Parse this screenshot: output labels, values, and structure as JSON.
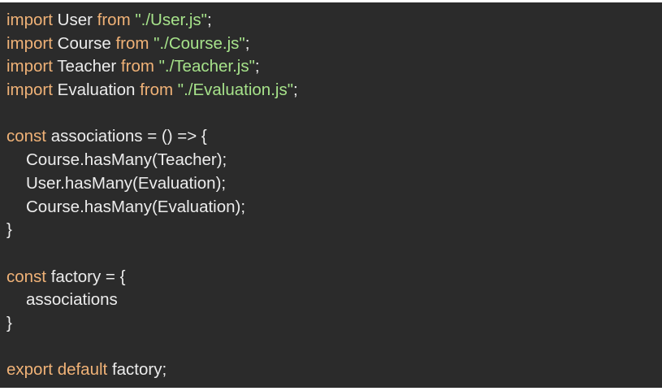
{
  "editor": {
    "lines": [
      {
        "t": [
          {
            "k": "kw",
            "v": "import"
          },
          {
            "k": "plain",
            "v": " User "
          },
          {
            "k": "kw",
            "v": "from"
          },
          {
            "k": "plain",
            "v": " "
          },
          {
            "k": "str",
            "v": "\"./User.js\""
          },
          {
            "k": "plain",
            "v": ";"
          }
        ]
      },
      {
        "t": [
          {
            "k": "kw",
            "v": "import"
          },
          {
            "k": "plain",
            "v": " Course "
          },
          {
            "k": "kw",
            "v": "from"
          },
          {
            "k": "plain",
            "v": " "
          },
          {
            "k": "str",
            "v": "\"./Course.js\""
          },
          {
            "k": "plain",
            "v": ";"
          }
        ]
      },
      {
        "t": [
          {
            "k": "kw",
            "v": "import"
          },
          {
            "k": "plain",
            "v": " Teacher "
          },
          {
            "k": "kw",
            "v": "from"
          },
          {
            "k": "plain",
            "v": " "
          },
          {
            "k": "str",
            "v": "\"./Teacher.js\""
          },
          {
            "k": "plain",
            "v": ";"
          }
        ]
      },
      {
        "t": [
          {
            "k": "kw",
            "v": "import"
          },
          {
            "k": "plain",
            "v": " Evaluation "
          },
          {
            "k": "kw",
            "v": "from"
          },
          {
            "k": "plain",
            "v": " "
          },
          {
            "k": "str",
            "v": "\"./Evaluation.js\""
          },
          {
            "k": "plain",
            "v": ";"
          }
        ]
      },
      {
        "t": []
      },
      {
        "t": [
          {
            "k": "kw",
            "v": "const"
          },
          {
            "k": "plain",
            "v": " associations = () => {"
          }
        ]
      },
      {
        "t": [
          {
            "k": "indent",
            "v": ""
          },
          {
            "k": "plain",
            "v": "Course.hasMany(Teacher);"
          }
        ]
      },
      {
        "t": [
          {
            "k": "indent",
            "v": ""
          },
          {
            "k": "plain",
            "v": "User.hasMany(Evaluation);"
          }
        ]
      },
      {
        "t": [
          {
            "k": "indent",
            "v": ""
          },
          {
            "k": "plain",
            "v": "Course.hasMany(Evaluation);"
          }
        ]
      },
      {
        "t": [
          {
            "k": "plain",
            "v": "}"
          }
        ]
      },
      {
        "t": []
      },
      {
        "t": [
          {
            "k": "kw",
            "v": "const"
          },
          {
            "k": "plain",
            "v": " factory = {"
          }
        ]
      },
      {
        "t": [
          {
            "k": "indent",
            "v": ""
          },
          {
            "k": "plain",
            "v": "associations"
          }
        ]
      },
      {
        "t": [
          {
            "k": "plain",
            "v": "}"
          }
        ]
      },
      {
        "t": []
      },
      {
        "t": [
          {
            "k": "kw",
            "v": "export"
          },
          {
            "k": "plain",
            "v": " "
          },
          {
            "k": "kw",
            "v": "default"
          },
          {
            "k": "plain",
            "v": " factory;"
          }
        ]
      }
    ]
  },
  "colors": {
    "background": "#2b2b2b",
    "keyword": "#f0b277",
    "string": "#a6e28a",
    "text": "#ececec"
  }
}
